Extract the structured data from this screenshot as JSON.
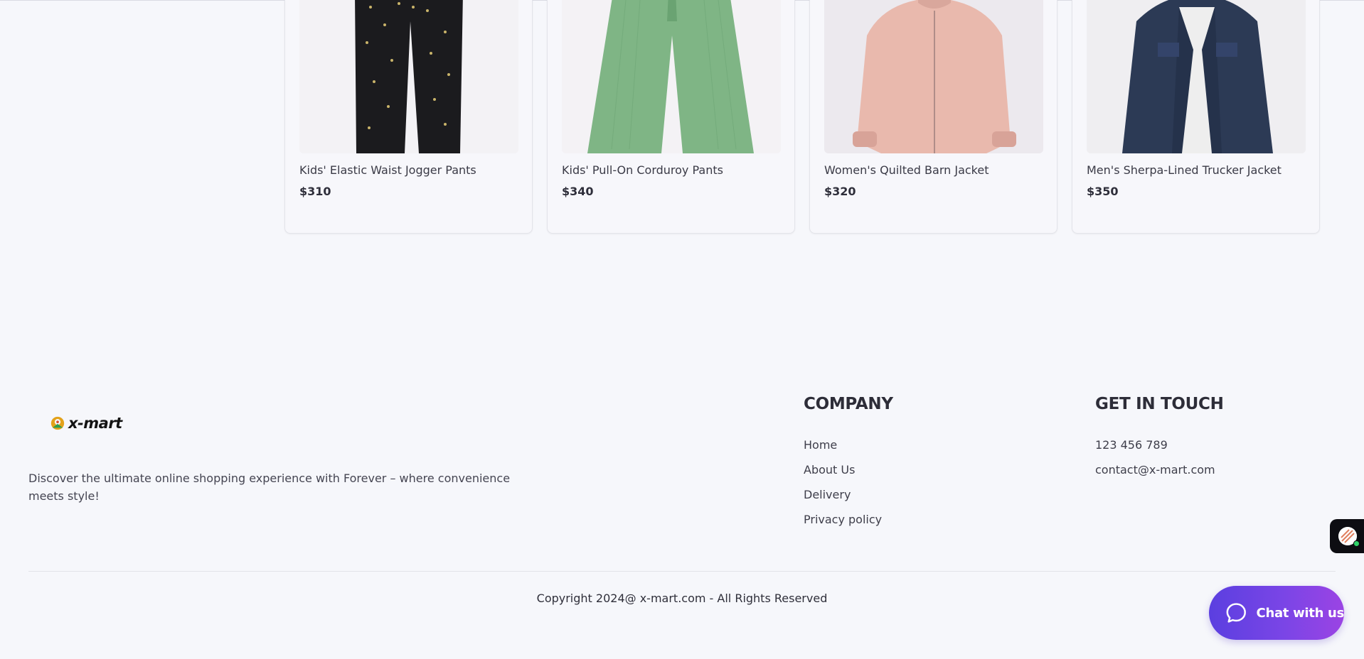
{
  "products": [
    {
      "name": "Kids' Elastic Waist Jogger Pants",
      "price": "$310"
    },
    {
      "name": "Kids' Pull-On Corduroy Pants",
      "price": "$340"
    },
    {
      "name": "Women's Quilted Barn Jacket",
      "price": "$320"
    },
    {
      "name": "Men's Sherpa-Lined Trucker Jacket",
      "price": "$350"
    }
  ],
  "footer": {
    "logo_text": "x-mart",
    "tagline": "Discover the ultimate online shopping experience with Forever – where convenience meets style!",
    "company": {
      "title": "COMPANY",
      "links": [
        "Home",
        "About Us",
        "Delivery",
        "Privacy policy"
      ]
    },
    "contact": {
      "title": "GET IN TOUCH",
      "phone": "123 456 789",
      "email": "contact@x-mart.com"
    },
    "copyright": "Copyright 2024@ x-mart.com - All Rights Reserved"
  },
  "chat": {
    "label": "Chat with us",
    "icon": "chat-bubble-icon"
  },
  "colors": {
    "chat_gradient_start": "#5b3fe0",
    "chat_gradient_end": "#9b44e4",
    "online_indicator": "#2fd46a"
  }
}
